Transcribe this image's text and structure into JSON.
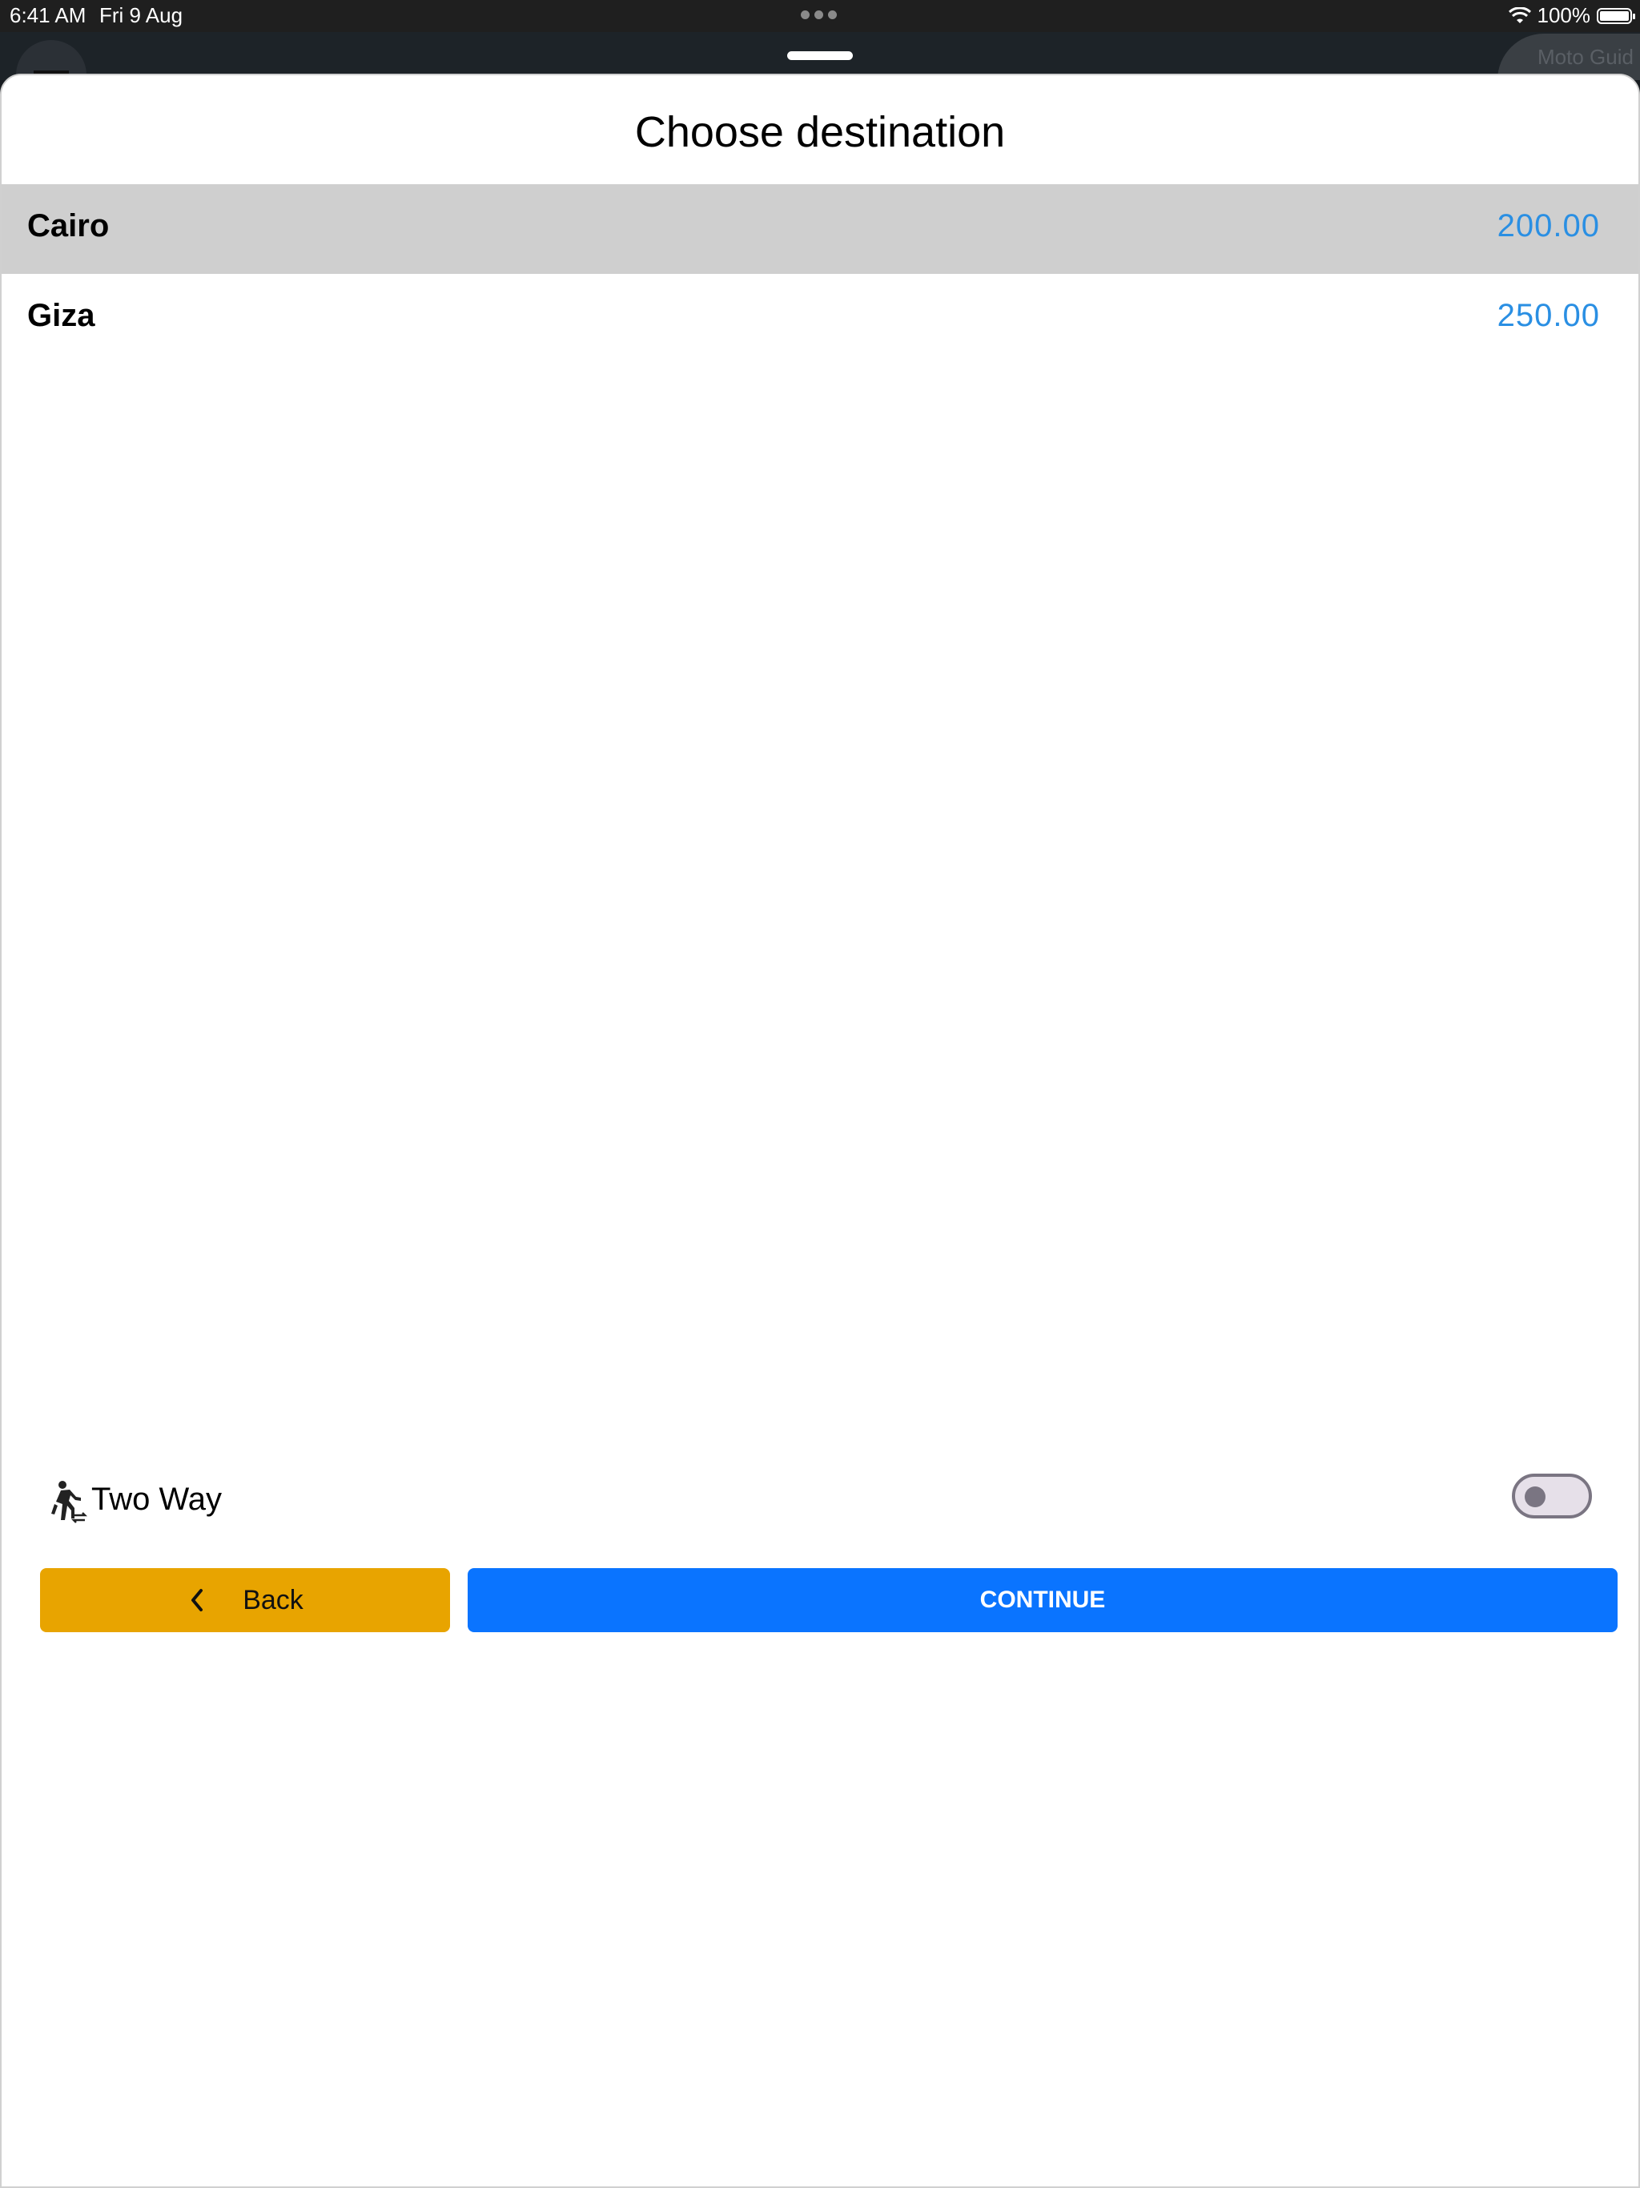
{
  "status_bar": {
    "time": "6:41 AM",
    "date": "Fri 9 Aug",
    "battery_percent": "100%",
    "icons": [
      "wifi-icon",
      "battery-icon"
    ]
  },
  "backdrop": {
    "place_label": "Moto Guid"
  },
  "sheet": {
    "title": "Choose destination",
    "destinations": [
      {
        "name": "Cairo",
        "price": "200.00",
        "selected": true
      },
      {
        "name": "Giza",
        "price": "250.00",
        "selected": false
      }
    ],
    "two_way": {
      "label": "Two Way",
      "enabled": false,
      "icon": "walk-two-way-icon"
    },
    "buttons": {
      "back_label": "Back",
      "continue_label": "CONTINUE"
    }
  },
  "colors": {
    "accent_price": "#2a8fe3",
    "back_button": "#e8a400",
    "continue_button": "#0a74ff",
    "selected_row": "#cfcfcf"
  }
}
